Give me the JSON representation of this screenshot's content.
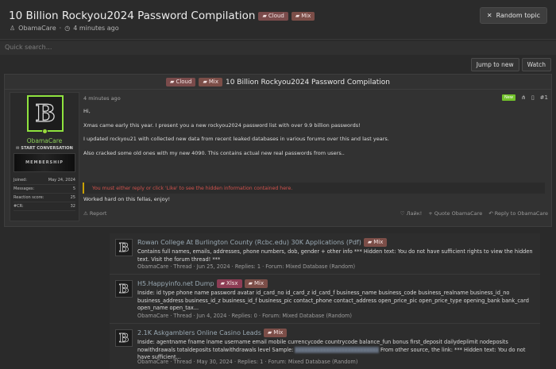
{
  "header": {
    "title": "10 Billion Rockyou2024 Password Compilation",
    "tags": [
      {
        "label": "Cloud"
      },
      {
        "label": "Mix"
      }
    ],
    "author": "ObamaCare",
    "time": "4 minutes ago",
    "random_label": "Random topic"
  },
  "search": {
    "placeholder": "Quick search..."
  },
  "actions": {
    "jump": "Jump to new",
    "watch": "Watch"
  },
  "post": {
    "title": "10 Billion Rockyou2024 Password Compilation",
    "tags": [
      {
        "label": "Cloud"
      },
      {
        "label": "Mix"
      }
    ],
    "user": {
      "name": "ObamaCare",
      "start_conversation": "START CONVERSATION",
      "banner_text": "MEMBERSHIP",
      "stats": [
        {
          "label": "Joined:",
          "value": "May 24, 2024"
        },
        {
          "label": "Messages:",
          "value": "5"
        },
        {
          "label": "Reaction score:",
          "value": "25"
        },
        {
          "label": "#CR:",
          "value": "32"
        }
      ]
    },
    "time": "4 minutes ago",
    "new_label": "New",
    "number": "#1",
    "lines": [
      "Hi,",
      "Xmas came early this year. I present you a new rockyou2024 password list with over 9.9 billion passwords!",
      "I updated rockyou21 with collected new data from recent leaked databases in various forums over this and last years.",
      "Also cracked some old ones with my new 4090. This contains actual new real passwords from users.."
    ],
    "hidden_notice": "You must either reply or click 'Like' to see the hidden information contained here.",
    "closing": "Worked hard on this fellas, enjoy!",
    "report": "Report",
    "like": "Лайк!",
    "quote": "+ Quote ObamaCare",
    "reply": "Reply to ObamaCare"
  },
  "related": [
    {
      "title": "Rowan College At Burlington County (Rcbc.edu) 30K Applications (Pdf)",
      "tags": [
        {
          "label": "Mix"
        }
      ],
      "desc": "Contains full names, emails, addresses, phone numbers, dob, gender + other info *** Hidden text: You do not have sufficient rights to view the hidden text. Visit the forum thread! ***",
      "meta": "ObamaCare · Thread · Jun 25, 2024 · Replies: 1 · Forum: Mixed Database (Random)"
    },
    {
      "title": "H5.Happyinfo.net Dump",
      "tags": [
        {
          "label": "Xlsx"
        },
        {
          "label": "Mix"
        }
      ],
      "desc": "Inside: id type phone name password avatar id_card_no id_card_z id_card_f business_name business_code business_realname business_id_no business_address business_id_z business_id_f business_pic contact_phone contact_address open_price_pic open_price_type opening_bank bank_card open_name open_tax...",
      "meta": "ObamaCare · Thread · Jun 4, 2024 · Replies: 0 · Forum: Mixed Database (Random)"
    },
    {
      "title": "2.1K Askgamblers Online Casino Leads",
      "tags": [
        {
          "label": "Mix"
        }
      ],
      "desc_pre": "Inside: agentname fname lname username email mobile currencycode countrycode balance_fun bonus first_deposit dailydeplimit nodeposits nowithdrawals totaldeposits totalwithdrawals level Sample: ",
      "desc_blur": "xxxxxxxxxxxxxxxxxxxxxxxxxxx",
      "desc_post": " From other source, the link: *** Hidden text: You do not have sufficient...",
      "meta": "ObamaCare · Thread · May 30, 2024 · Replies: 1 · Forum: Mixed Database (Random)"
    }
  ]
}
